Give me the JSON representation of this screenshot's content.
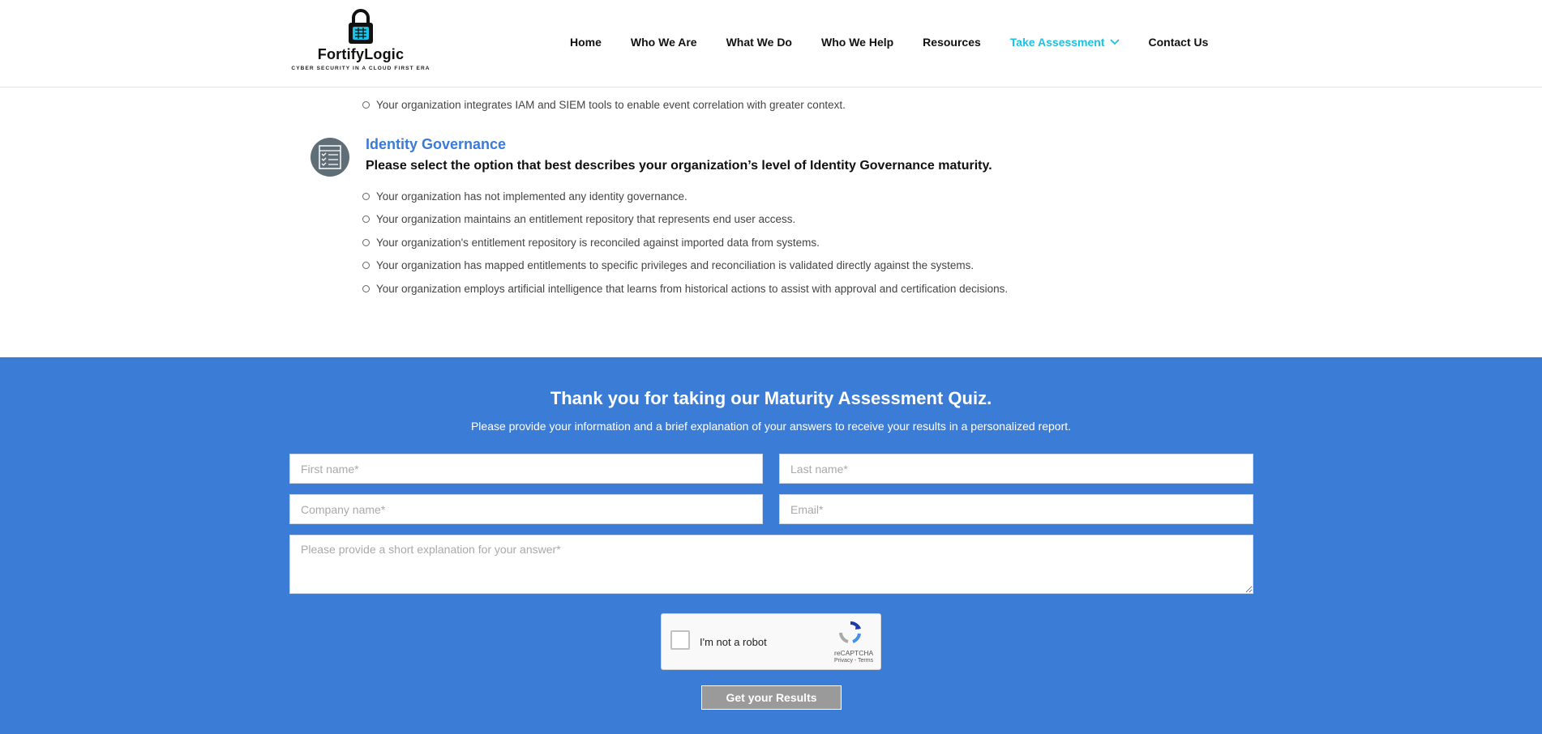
{
  "brand": {
    "name": "FortifyLogic",
    "tagline": "CYBER SECURITY IN A CLOUD FIRST ERA",
    "logo_icon": "padlock-icon",
    "accent": "#19c2e6"
  },
  "nav": {
    "items": [
      {
        "label": "Home"
      },
      {
        "label": "Who We Are"
      },
      {
        "label": "What We Do"
      },
      {
        "label": "Who We Help"
      },
      {
        "label": "Resources"
      },
      {
        "label": "Take Assessment",
        "active": true,
        "icon": "chevron-down-icon"
      },
      {
        "label": "Contact Us"
      }
    ]
  },
  "quiz": {
    "previous_option": "Your organization integrates IAM and SIEM tools to enable event correlation with greater context.",
    "section": {
      "icon": "checklist-icon",
      "title": "Identity Governance",
      "question": "Please select the option that best describes your organization’s level of Identity Governance maturity.",
      "options": [
        "Your organization has not implemented any identity governance.",
        "Your organization maintains an entitlement repository that represents end user access.",
        "Your organization's entitlement repository is reconciled against imported data from systems.",
        "Your organization has mapped entitlements to specific privileges and reconciliation is validated directly against the systems.",
        "Your organization employs artificial intelligence that learns from historical actions to assist with approval and certification decisions."
      ]
    }
  },
  "form": {
    "title": "Thank you for taking our Maturity Assessment Quiz.",
    "subtitle": "Please provide your information and a brief explanation of your answers to receive your results in a personalized report.",
    "first_name_placeholder": "First name*",
    "last_name_placeholder": "Last name*",
    "company_placeholder": "Company name*",
    "email_placeholder": "Email*",
    "explanation_placeholder": "Please provide a short explanation for your answer*",
    "captcha_label": "I'm not a robot",
    "captcha_brand": "reCAPTCHA",
    "captcha_links": "Privacy - Terms",
    "submit_label": "Get your Results",
    "band_color": "#3b7cd7"
  }
}
